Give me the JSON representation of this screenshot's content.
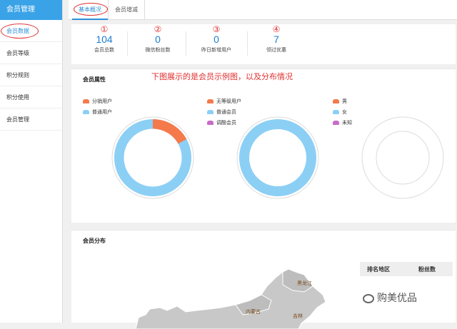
{
  "sidebar": {
    "header": "会员管理",
    "items": [
      {
        "label": "会员数据"
      },
      {
        "label": "会员等级"
      },
      {
        "label": "积分规则"
      },
      {
        "label": "积分使用"
      },
      {
        "label": "会员管理"
      }
    ]
  },
  "tabs": [
    {
      "label": "基本概况"
    },
    {
      "label": "会员增减"
    }
  ],
  "stats": [
    {
      "mark": "①",
      "value": "104",
      "label": "会员总数"
    },
    {
      "mark": "②",
      "value": "0",
      "label": "微信粉丝数"
    },
    {
      "mark": "③",
      "value": "0",
      "label": "昨日新增用户"
    },
    {
      "mark": "④",
      "value": "7",
      "label": "领过优惠"
    }
  ],
  "attributes": {
    "title": "会员属性",
    "note": "下图展示的是会员示例图，以及分布情况",
    "legend1": [
      {
        "label": "分销用户",
        "color": "#f47a4c"
      },
      {
        "label": "普通用户",
        "color": "#8ccff5"
      }
    ],
    "legend2": [
      {
        "label": "无等级用户",
        "color": "#f47a4c"
      },
      {
        "label": "普通会员",
        "color": "#8ccff5"
      },
      {
        "label": "调酸会员",
        "color": "#c96bc8"
      }
    ],
    "legend3": [
      {
        "label": "男",
        "color": "#f47a4c"
      },
      {
        "label": "女",
        "color": "#8ccff5"
      },
      {
        "label": "未知",
        "color": "#c96bc8"
      }
    ],
    "donut1": {
      "orange_fraction": 0.17,
      "blue_fraction": 0.83
    },
    "donut2": {
      "blue_fraction": 1.0
    }
  },
  "distribution": {
    "title": "会员分布",
    "table_headers": [
      "排名地区",
      "粉丝数"
    ],
    "map_labels": [
      "黑龙江",
      "内蒙古",
      "吉林"
    ]
  },
  "watermark": "购美优品",
  "colors": {
    "accent": "#3aa3e8",
    "annotation": "#e03030",
    "value": "#1a7fcf"
  }
}
